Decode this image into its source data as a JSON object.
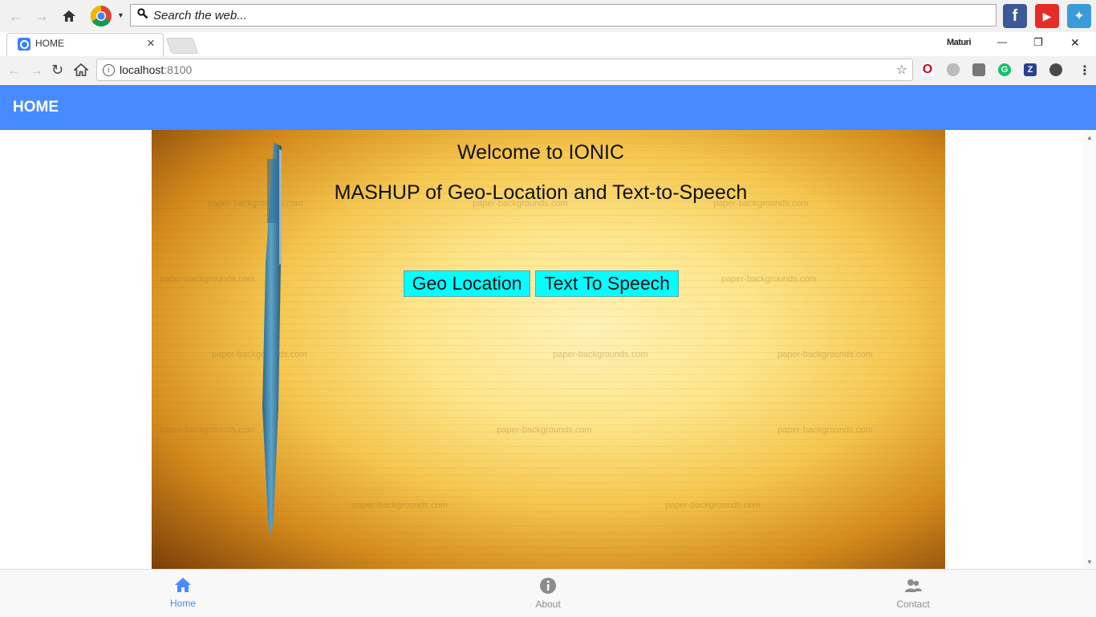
{
  "ext_toolbar": {
    "search_placeholder": "Search the web...",
    "apps": [
      {
        "name": "facebook",
        "glyph": "f",
        "color": "#3b5998"
      },
      {
        "name": "youtube",
        "glyph": "▶",
        "color": "#e52d27"
      },
      {
        "name": "games",
        "glyph": "✦",
        "color": "#3a9bd9"
      }
    ]
  },
  "tab": {
    "title": "HOME",
    "close": "×"
  },
  "window": {
    "user": "Maturi",
    "minimize": "—",
    "restore": "❐",
    "close": "✕"
  },
  "address": {
    "host": "localhost",
    "port": ":8100"
  },
  "app": {
    "header_title": "HOME",
    "welcome": "Welcome to IONIC",
    "subtitle": "MASHUP of Geo-Location and Text-to-Speech",
    "buttons": {
      "geo": "Geo Location",
      "tts": "Text To Speech"
    },
    "watermark": "paper-backgrounds.com"
  },
  "tabs": [
    {
      "label": "Home",
      "icon": "home-icon",
      "active": true
    },
    {
      "label": "About",
      "icon": "info-icon",
      "active": false
    },
    {
      "label": "Contact",
      "icon": "contacts-icon",
      "active": false
    }
  ],
  "colors": {
    "header": "#488aff",
    "button_bg": "#00ffff",
    "tab_active": "#488aff",
    "tab_inactive": "#8c8c8c"
  }
}
